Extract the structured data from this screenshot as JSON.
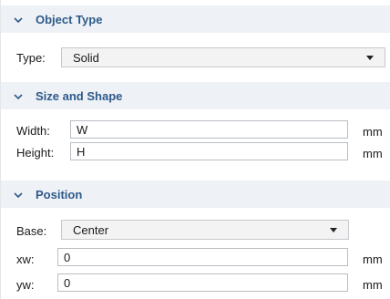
{
  "sections": {
    "object_type": {
      "title": "Object Type",
      "type_label": "Type:",
      "type_value": "Solid"
    },
    "size_shape": {
      "title": "Size and Shape",
      "width_label": "Width:",
      "width_value": "W",
      "width_unit": "mm",
      "height_label": "Height:",
      "height_value": "H",
      "height_unit": "mm"
    },
    "position": {
      "title": "Position",
      "base_label": "Base:",
      "base_value": "Center",
      "xw_label": "xw:",
      "xw_value": "0",
      "xw_unit": "mm",
      "yw_label": "yw:",
      "yw_value": "0",
      "yw_unit": "mm"
    }
  },
  "colors": {
    "header_bg": "#eef1f6",
    "header_text": "#2e5a8a"
  },
  "icons": {
    "section_toggle": "chevron-down-icon",
    "dropdown": "dropdown-arrow-icon"
  }
}
